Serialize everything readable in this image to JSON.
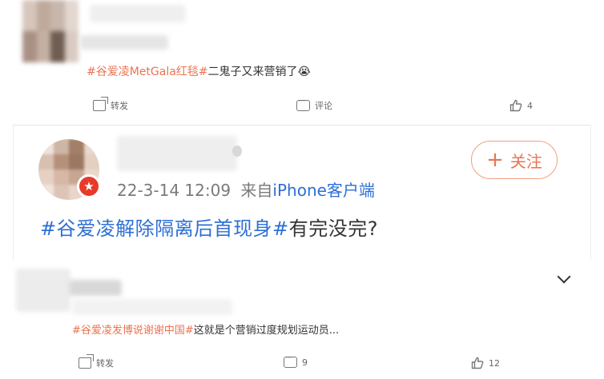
{
  "post1": {
    "hashtag": "#谷爱凌MetGala红毯#",
    "text": "二鬼子又来营销了",
    "emoji": "😭",
    "actions": {
      "repost": "转发",
      "comment": "评论",
      "likes": "4"
    }
  },
  "quoted": {
    "timestamp": "22-3-14 12:09",
    "source_prefix": "来自",
    "source": "iPhone客户端",
    "follow_label": "关注",
    "follow_plus": "+",
    "hashtag": "#谷爱凌解除隔离后首现身#",
    "text": "有完没完?"
  },
  "post3": {
    "hashtag": "#谷爱凌发博说谢谢中国#",
    "text": "这就是个营销过度规划运动员...",
    "actions": {
      "repost": "转发",
      "comments": "9",
      "likes": "12"
    }
  },
  "colors": {
    "accent": "#eb7350",
    "link": "#2e6fd6",
    "vip": "#e73a2a"
  },
  "icons": [
    "repost-icon",
    "comment-icon",
    "like-icon",
    "chevron-down-icon",
    "plus-icon"
  ]
}
